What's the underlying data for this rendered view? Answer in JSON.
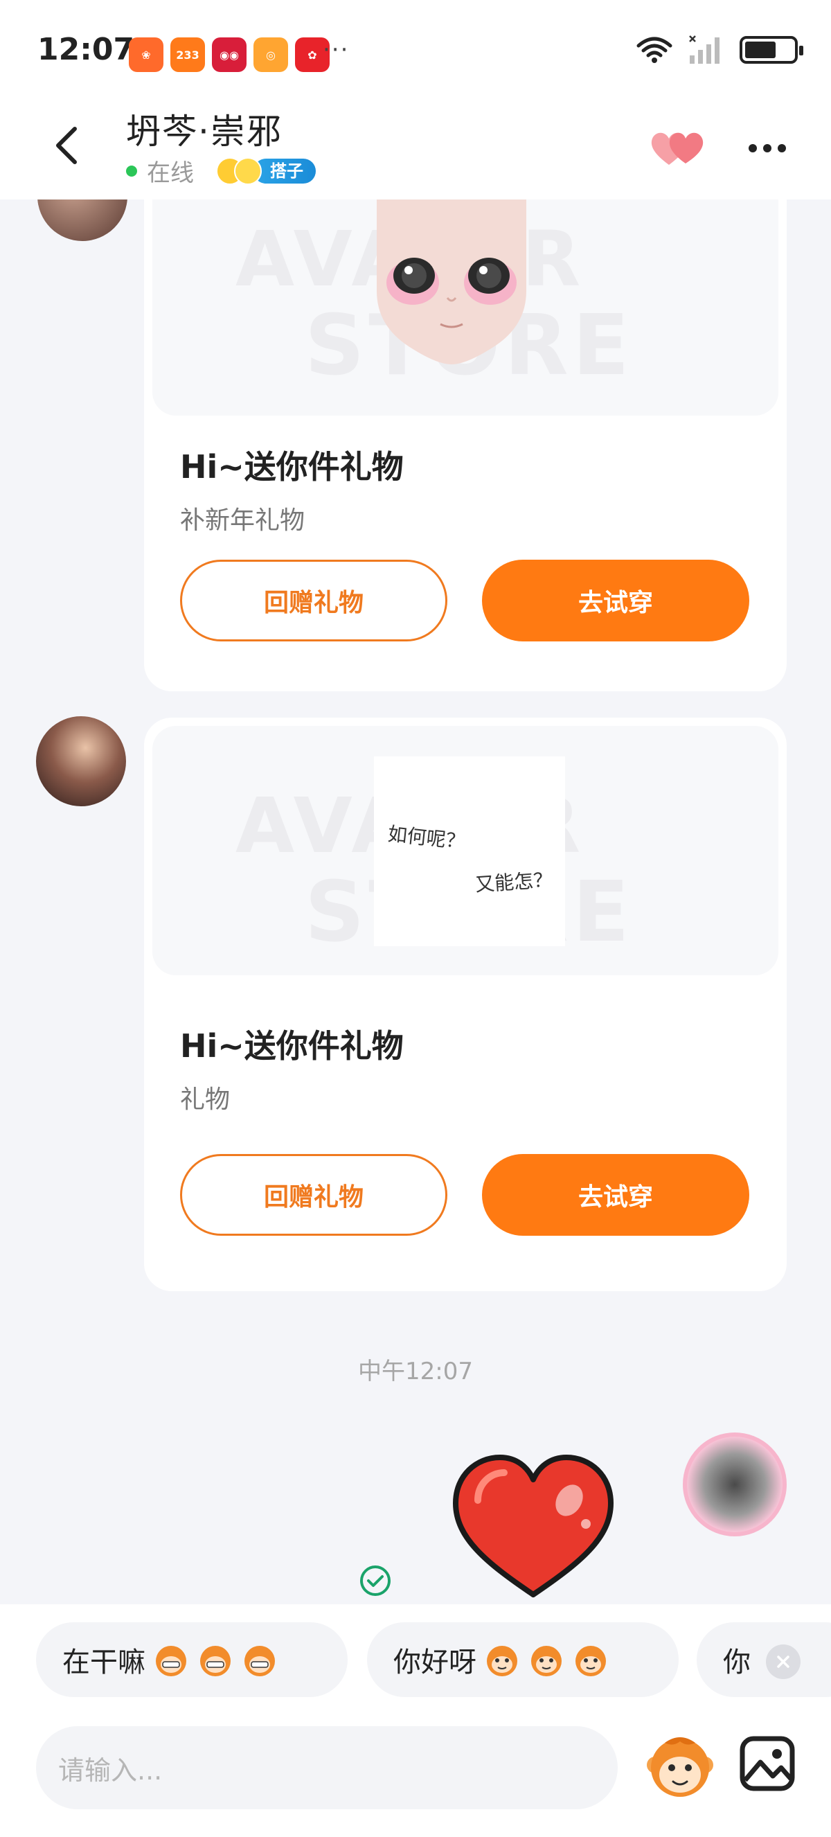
{
  "status_bar": {
    "time": "12:07",
    "app_icons": [
      {
        "name": "kuaikan-icon",
        "color": "#ff6a2b",
        "glyph": "❀"
      },
      {
        "name": "233-icon",
        "color": "#ff7a1a",
        "glyph": "233"
      },
      {
        "name": "tmall-icon",
        "color": "#d81e3a",
        "glyph": "◉◉"
      },
      {
        "name": "orange-app-icon",
        "color": "#ffa531",
        "glyph": "◎"
      },
      {
        "name": "pdd-icon",
        "color": "#e8232a",
        "glyph": "✿"
      }
    ],
    "more": "···"
  },
  "header": {
    "title": "坍芩·崇邪",
    "status_text": "在线",
    "badge_label": "搭子",
    "colors": {
      "online": "#2bc658",
      "badge": "#1b8cd8"
    }
  },
  "cards": [
    {
      "title": "Hi~送你件礼物",
      "subtitle": "补新年礼物",
      "return_gift_label": "回赠礼物",
      "try_on_label": "去试穿"
    },
    {
      "title": "Hi~送你件礼物",
      "subtitle": "礼物",
      "return_gift_label": "回赠礼物",
      "try_on_label": "去试穿",
      "image_text_1": "如何呢？",
      "image_text_2": "又能怎？"
    }
  ],
  "timestamp": "中午12:07",
  "quick_replies": [
    {
      "text": "在干嘛"
    },
    {
      "text": "你好呀"
    },
    {
      "text": "你"
    }
  ],
  "input": {
    "placeholder": "请输入..."
  },
  "accent_color": "#ff7a12"
}
